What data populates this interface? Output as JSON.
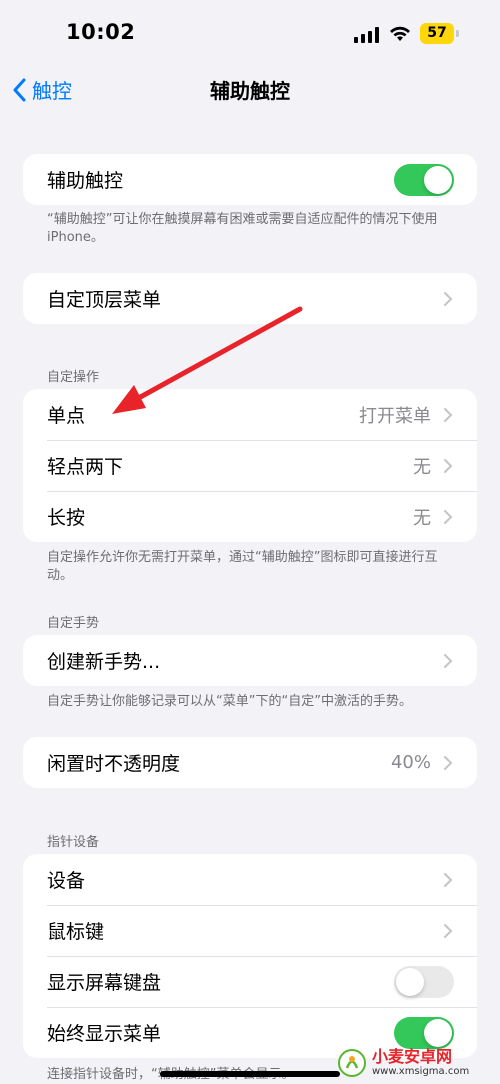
{
  "status_bar": {
    "time": "10:02",
    "battery": "57"
  },
  "nav": {
    "back_label": "触控",
    "title": "辅助触控"
  },
  "assistive_touch": {
    "label": "辅助触控",
    "enabled": true,
    "footer": "“辅助触控”可让你在触摸屏幕有困难或需要自适应配件的情况下使用iPhone。"
  },
  "top_menu": {
    "label": "自定顶层菜单"
  },
  "custom_actions": {
    "header": "自定操作",
    "items": [
      {
        "label": "单点",
        "value": "打开菜单"
      },
      {
        "label": "轻点两下",
        "value": "无"
      },
      {
        "label": "长按",
        "value": "无"
      }
    ],
    "footer": "自定操作允许你无需打开菜单，通过“辅助触控”图标即可直接进行互动。"
  },
  "custom_gestures": {
    "header": "自定手势",
    "create_label": "创建新手势...",
    "footer": "自定手势让你能够记录可以从“菜单”下的“自定”中激活的手势。"
  },
  "idle_opacity": {
    "label": "闲置时不透明度",
    "value": "40%"
  },
  "pointer_devices": {
    "header": "指针设备",
    "devices_label": "设备",
    "mouse_keys_label": "鼠标键",
    "show_keyboard_label": "显示屏幕键盘",
    "show_keyboard_enabled": false,
    "always_show_menu_label": "始终显示菜单",
    "always_show_menu_enabled": true,
    "footer": "连接指针设备时，“辅助触控”菜单会显示。"
  },
  "watermark": {
    "title": "小麦安卓网",
    "url": "www.xmsigma.com"
  },
  "colors": {
    "accent": "#007aff",
    "toggle_on": "#34c759",
    "arrow": "#e8242a"
  }
}
